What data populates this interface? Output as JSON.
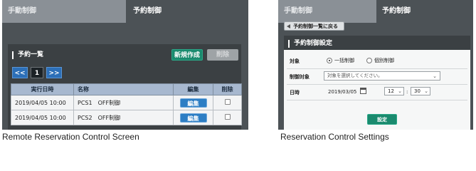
{
  "left_screen": {
    "tabs": [
      "手動制御",
      "予約制御"
    ],
    "section_title": "予約一覧",
    "new_button": "新規作成",
    "delete_button": "削除",
    "pager": {
      "prev": "<<",
      "page": "1",
      "next": ">>"
    },
    "table": {
      "headers": [
        "実行日時",
        "名称",
        "編集",
        "削除"
      ],
      "rows": [
        {
          "datetime": "2019/04/05 10:00",
          "name": "PCS1　OFF制御",
          "edit": "編集"
        },
        {
          "datetime": "2019/04/05 10:00",
          "name": "PCS2　OFF制御",
          "edit": "編集"
        }
      ]
    },
    "caption": "Remote Reservation Control Screen"
  },
  "right_screen": {
    "tabs": [
      "手動制御",
      "予約制御"
    ],
    "back_button": "予約制御一覧に戻る",
    "section_title": "予約制御設定",
    "target_label": "対象",
    "radio_options": [
      {
        "label": "一括制御",
        "selected": true
      },
      {
        "label": "個別制御",
        "selected": false
      }
    ],
    "control_target_label": "制御対象",
    "control_target_placeholder": "対象を選択してください。",
    "datetime_label": "日時",
    "date": "2019/03/05",
    "hour": "12",
    "minute": "30",
    "colon": ":",
    "set_button": "設定",
    "caption": "Reservation Control Settings"
  },
  "colors": {
    "dark_bg": "#4c5256",
    "accent_green": "#1a8a6e",
    "accent_blue": "#2d7ec4",
    "table_header": "#a7b8cf"
  }
}
